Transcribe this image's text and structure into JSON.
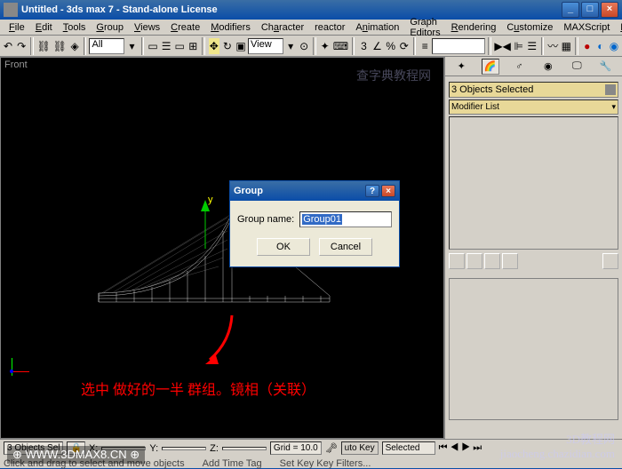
{
  "window": {
    "title": "Untitled - 3ds max 7 - Stand-alone License",
    "min": "_",
    "max": "□",
    "close": "×"
  },
  "menu": [
    "File",
    "Edit",
    "Tools",
    "Group",
    "Views",
    "Create",
    "Modifiers",
    "Character",
    "reactor",
    "Animation",
    "Graph Editors",
    "Rendering",
    "Customize",
    "MAXScript",
    "Help"
  ],
  "toolbar": {
    "dd1": "All",
    "dd2": "View"
  },
  "viewport": {
    "label": "Front"
  },
  "annotation": "选中 做好的一半   群组。镜相（关联）",
  "sidepanel": {
    "sel": "3 Objects Selected",
    "mod": "Modifier List"
  },
  "dialog": {
    "title": "Group",
    "label": "Group name:",
    "value": "Group01",
    "ok": "OK",
    "cancel": "Cancel",
    "help": "?",
    "close": "×"
  },
  "status": {
    "objs": "3 Objects Sel",
    "x": "X:",
    "y": "Y:",
    "z": "Z:",
    "grid": "Grid = 10.0",
    "hint": "Click and drag to select and move objects",
    "addtag": "Add Time Tag",
    "auto": "uto Key",
    "selkey": "Selected",
    "setkey": "Set Key  Key Filters..."
  },
  "wm": {
    "a": "查字典教程网",
    "b": "3D教程网\njiaocheng.chazidian.com",
    "c": "⊕ WWW.3DMAX8.CN ⊕"
  }
}
